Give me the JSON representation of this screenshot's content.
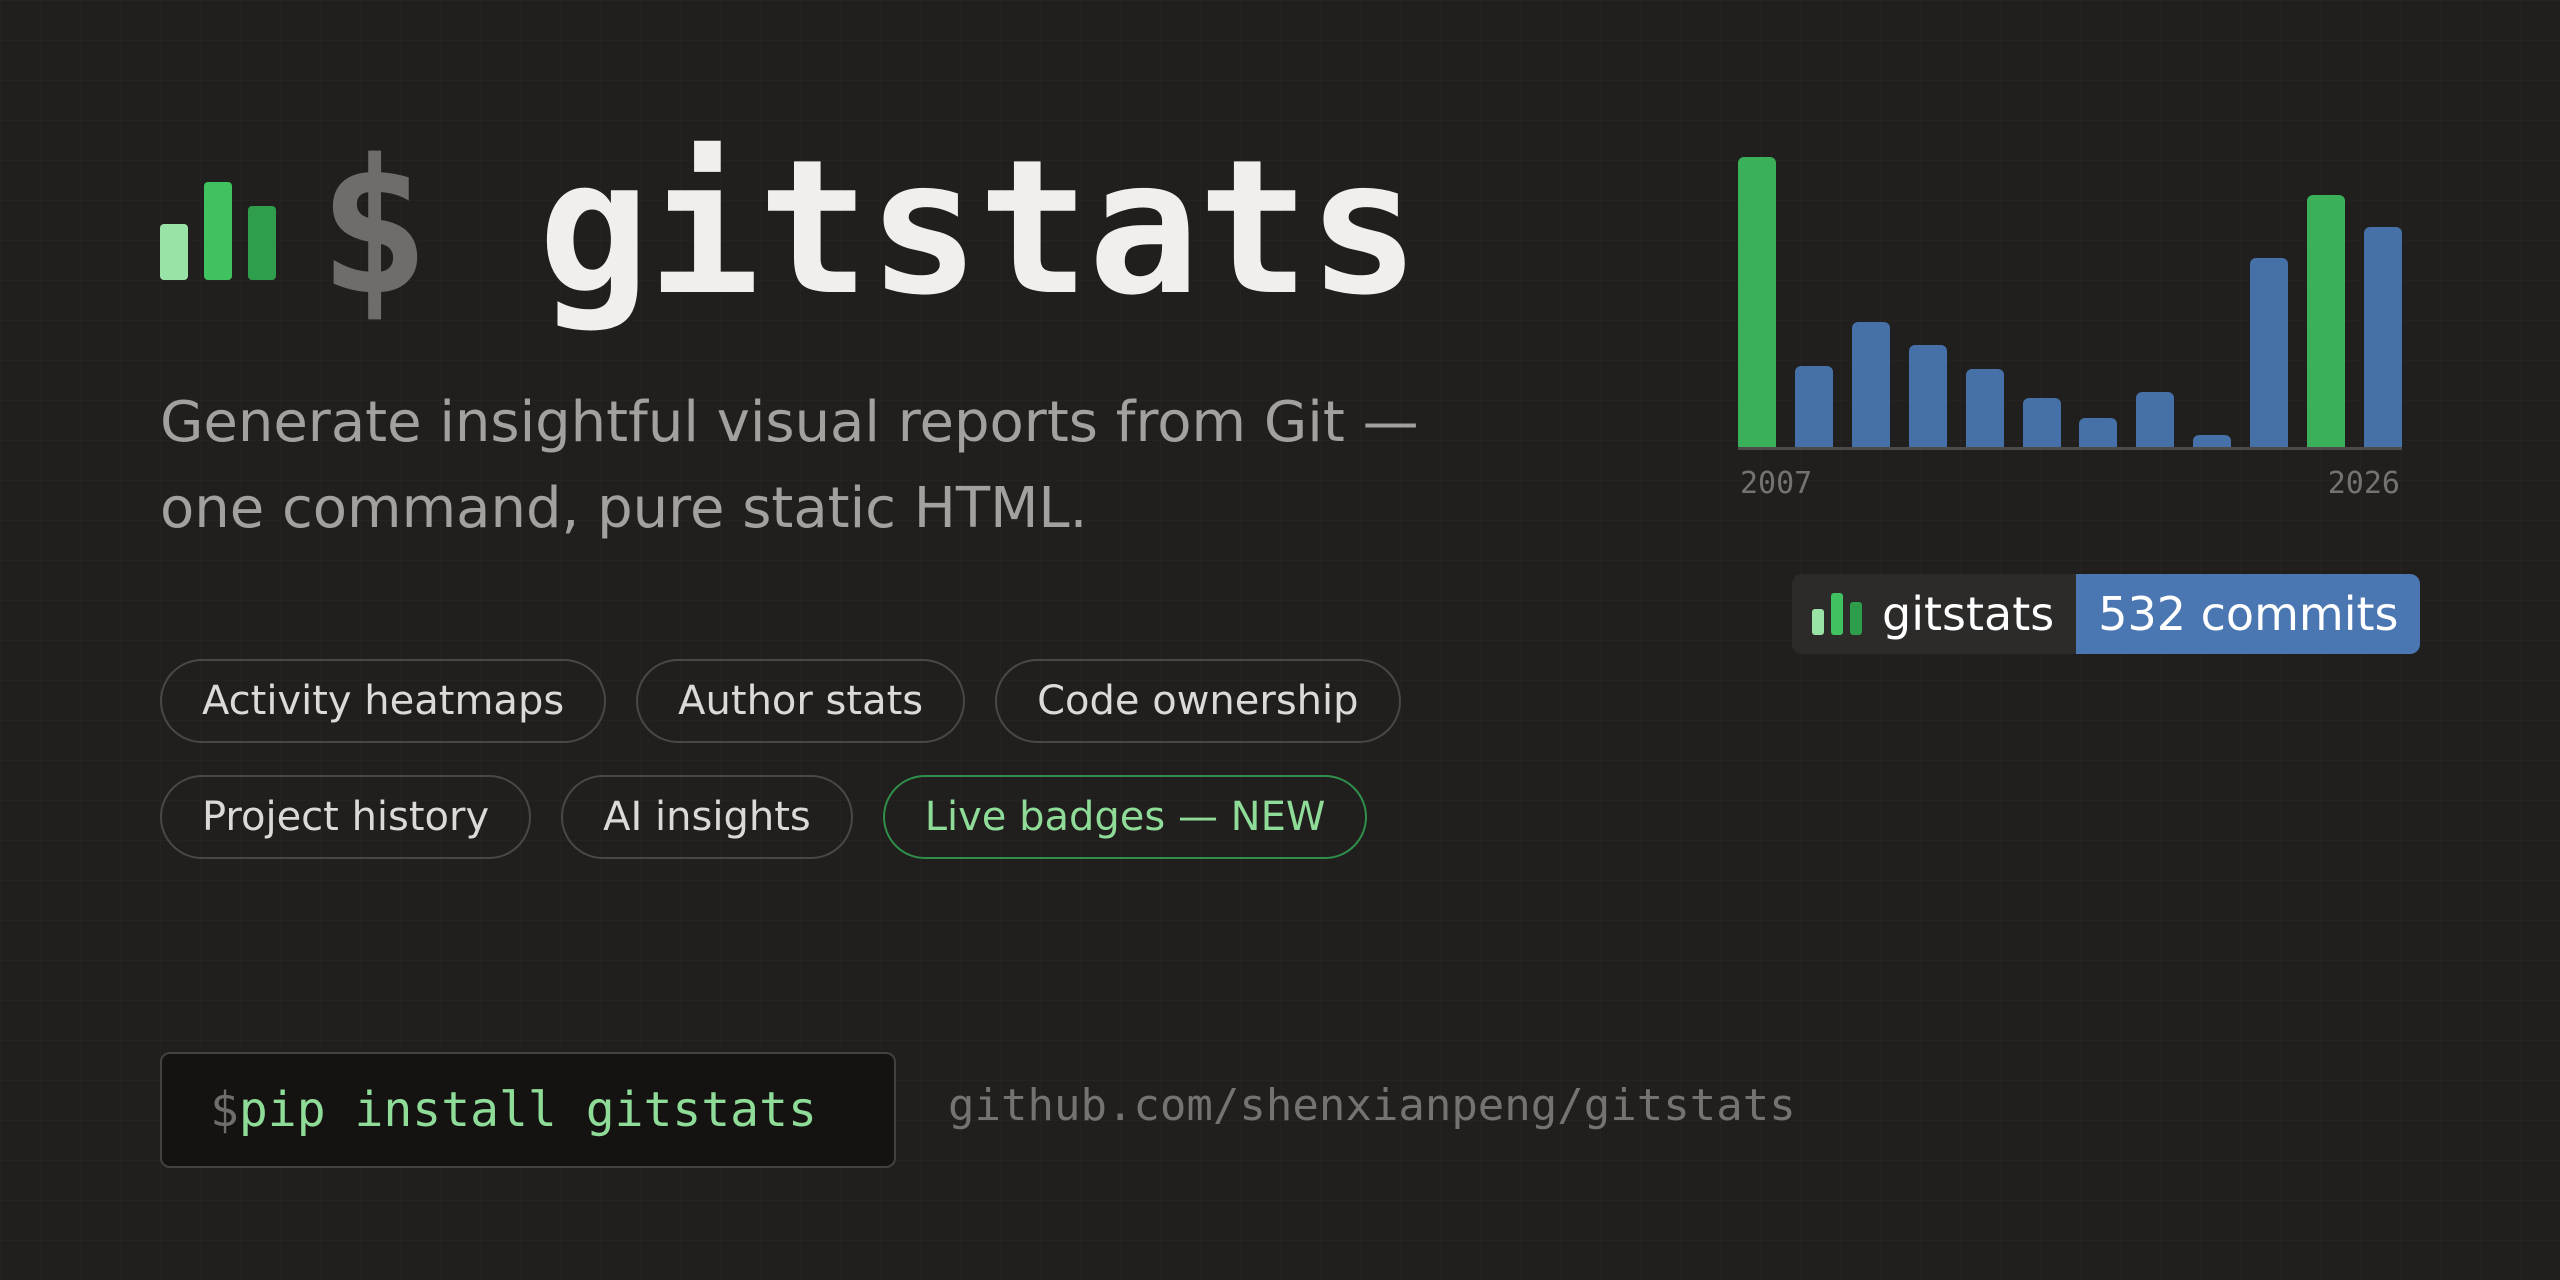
{
  "header": {
    "prompt": "$",
    "title": "gitstats",
    "logo_icon": "bar-chart-icon",
    "logo_colors": [
      "#9ae3a6",
      "#3fc25f",
      "#2f9e4c"
    ]
  },
  "tagline": {
    "line1": "Generate insightful visual reports from Git —",
    "line2": "one command, pure static HTML."
  },
  "features": {
    "row1": [
      "Activity heatmaps",
      "Author stats",
      "Code ownership"
    ],
    "row2": [
      "Project history",
      "AI insights"
    ],
    "new_feature": "Live badges — NEW"
  },
  "install": {
    "prompt": "$",
    "command": "pip install gitstats"
  },
  "repo_url": "github.com/shenxianpeng/gitstats",
  "chart_data": {
    "type": "bar",
    "x_start_label": "2007",
    "x_end_label": "2026",
    "values": [
      100,
      28,
      43,
      35,
      27,
      17,
      10,
      19,
      4,
      65,
      87,
      76
    ],
    "highlighted": [
      true,
      false,
      false,
      false,
      false,
      false,
      false,
      false,
      false,
      false,
      true,
      false
    ],
    "colors": {
      "default": "#4670a8",
      "highlight": "#3bb05a"
    }
  },
  "badge": {
    "label": "gitstats",
    "value": "532 commits",
    "icon": "bar-chart-icon"
  }
}
